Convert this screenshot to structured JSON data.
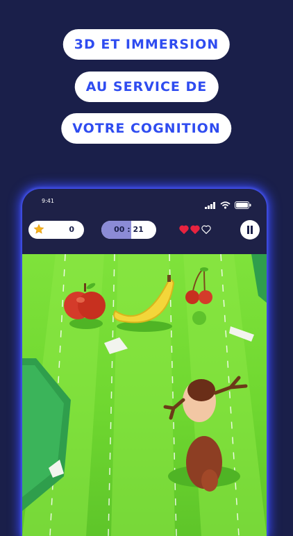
{
  "headline": {
    "line1": "3D ET IMMERSION",
    "line2": "AU SERVICE DE",
    "line3": "VOTRE COGNITION"
  },
  "status_bar": {
    "time": "9:41"
  },
  "hud": {
    "score": "0",
    "timer": "00 : 21",
    "timer_progress": 0.55,
    "lives_total": 3,
    "lives_remaining": 2
  },
  "colors": {
    "background": "#1a1f4a",
    "headline_text": "#2f4cf0",
    "grass": "#7fe23b",
    "heart": "#e8233f",
    "timer_fill": "#8b8bd6"
  },
  "icons": [
    "star-icon",
    "heart-icon",
    "pause-icon",
    "signal-icon",
    "wifi-icon",
    "battery-icon"
  ]
}
